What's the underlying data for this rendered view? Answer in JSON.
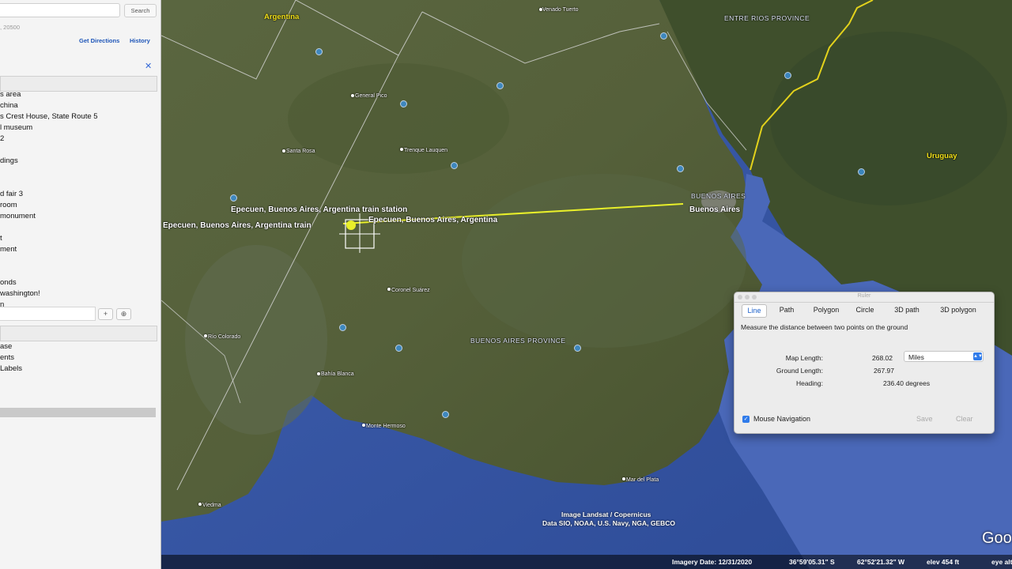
{
  "sidebar": {
    "search_button": "Search",
    "search_subtext": ", 20500",
    "get_directions": "Get Directions",
    "history": "History",
    "close_glyph": "✕",
    "places": [
      "s area",
      "china",
      "s Crest House, State Route 5",
      "l museum",
      "2",
      "",
      "dings",
      "",
      "",
      "d fair 3",
      "room",
      " monument",
      "",
      "t",
      "ment",
      "",
      "",
      "onds",
      "washington!",
      "n"
    ],
    "add_glyph": "+",
    "folder_glyph": "⊕",
    "layers": [
      "ase",
      "ents",
      " Labels"
    ]
  },
  "map": {
    "labels": {
      "argentina": "Argentina",
      "entre_rios": "ENTRE RIOS PROVINCE",
      "venado_tuerto": "Venado Tuerto",
      "general_pico": "General Pico",
      "santa_rosa": "Santa Rosa",
      "trenque_lauquen": "Trenque Lauquen",
      "uruguay": "Uruguay",
      "buenos_aires_caps": "BUENOS AIRES",
      "buenos_aires": "Buenos Aires",
      "epecuen_station_1": "Epecuen, Buenos Aires, Argentina train station",
      "epecuen_station_2": "Epecuen, Buenos Aires, Argentina train",
      "epecuen": "Epecuen, Buenos Aires, Argentina",
      "coronel_suarez": "Coronel Suárez",
      "province": "BUENOS AIRES PROVINCE",
      "rio_colorado": "Río Colorado",
      "bahia_blanca": "Bahía Blanca",
      "monte_hermoso": "Monte Hermoso",
      "mar_del_plata": "Mar del Plata",
      "viedma": "Viedma"
    },
    "attribution_1": "Image Landsat / Copernicus",
    "attribution_2": "Data SIO, NOAA, U.S. Navy, NGA, GEBCO",
    "google_logo": "Goo",
    "status": {
      "imagery_date": "Imagery Date: 12/31/2020",
      "lat": "36°59'05.31\" S",
      "lon": "62°52'21.32\" W",
      "elev": "elev  454 ft",
      "eye": "eye alt"
    }
  },
  "ruler": {
    "title": "Ruler",
    "tabs": [
      "Line",
      "Path",
      "Polygon",
      "Circle",
      "3D path",
      "3D polygon"
    ],
    "active_tab": "Line",
    "description": "Measure the distance between two points on the ground",
    "map_length_label": "Map Length:",
    "map_length_value": "268.02",
    "unit": "Miles",
    "ground_length_label": "Ground Length:",
    "ground_length_value": "267.97",
    "heading_label": "Heading:",
    "heading_value": "236.40 degrees",
    "mouse_navigation": "Mouse Navigation",
    "mouse_navigation_checked": true,
    "save": "Save",
    "clear": "Clear"
  },
  "colors": {
    "measure_line": "#e8ef2a",
    "border_yellow": "#e3d21c",
    "ocean": "#3d5aa8",
    "land": "#4e5a34",
    "accent": "#2f7bea"
  }
}
